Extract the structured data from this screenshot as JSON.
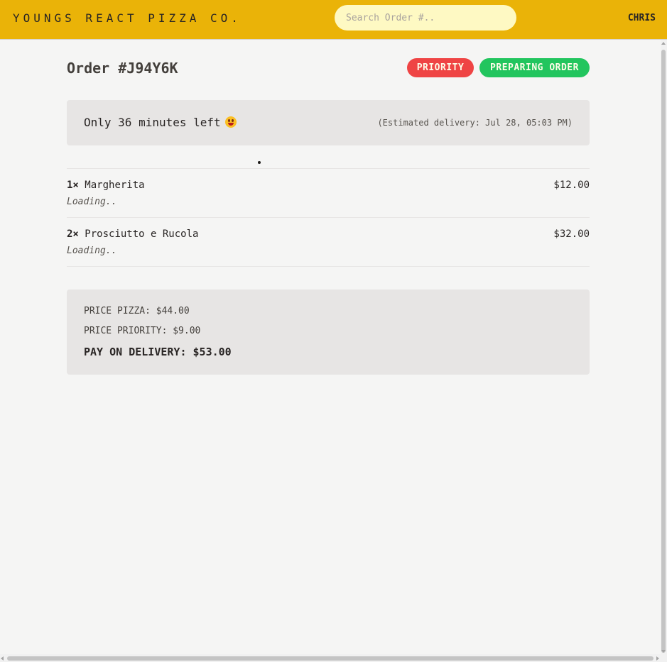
{
  "header": {
    "brand": "YOUNGS REACT PIZZA CO.",
    "search_placeholder": "Search Order #..",
    "username": "CHRIS"
  },
  "order": {
    "title": "Order #J94Y6K",
    "priority_badge": "PRIORITY",
    "status_badge": "PREPARING ORDER",
    "time_left": "Only 36 minutes left",
    "estimated_delivery": "(Estimated delivery: Jul 28, 05:03 PM)",
    "items": [
      {
        "quantity": "1×",
        "name": "Margherita",
        "price": "$12.00",
        "ingredients": "Loading.."
      },
      {
        "quantity": "2×",
        "name": "Prosciutto e Rucola",
        "price": "$32.00",
        "ingredients": "Loading.."
      }
    ],
    "summary": {
      "price_pizza": "PRICE PIZZA: $44.00",
      "price_priority": "PRICE PRIORITY: $9.00",
      "pay_on_delivery": "PAY ON DELIVERY: $53.00"
    }
  },
  "colors": {
    "header": "#eab308",
    "search": "#fef9c3",
    "background": "#f5f5f4",
    "panel": "#e7e5e4",
    "priority": "#ef4444",
    "status": "#22c55e"
  },
  "icons": {
    "eta": "grinning-face-emoji"
  }
}
